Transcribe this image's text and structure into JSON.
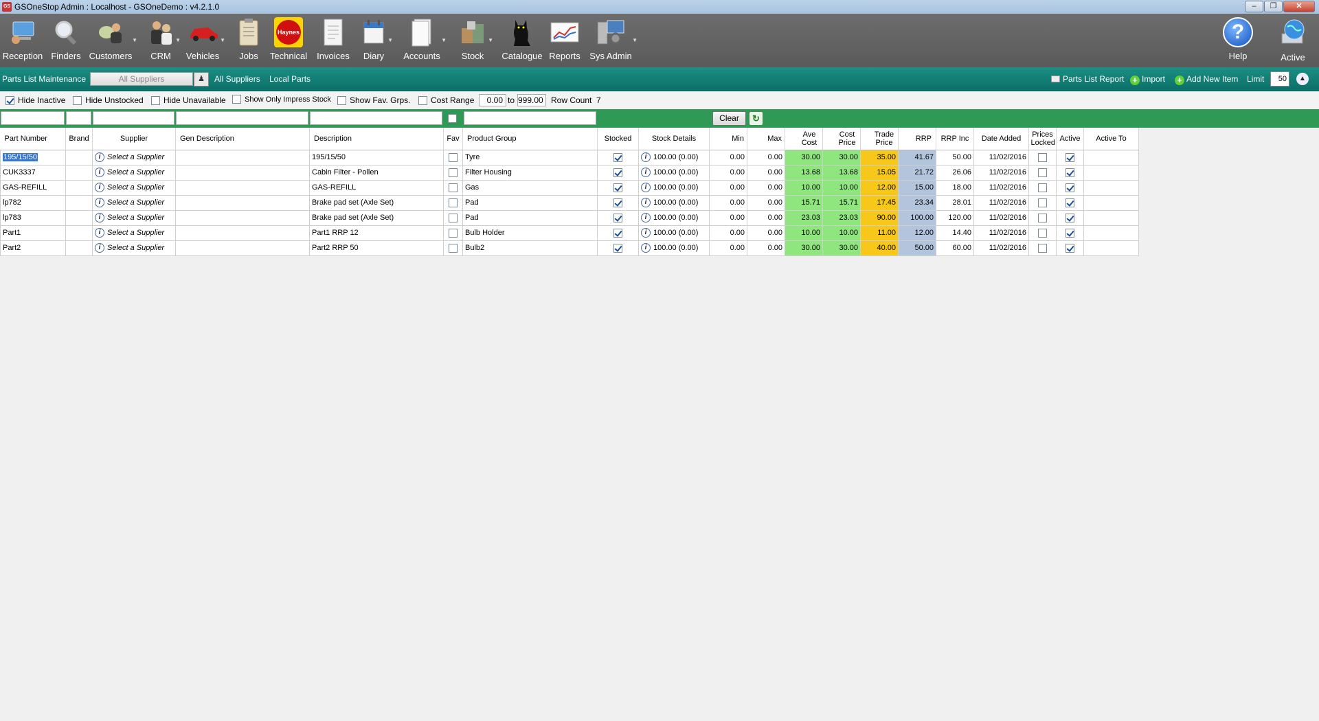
{
  "window": {
    "title": "GSOneStop Admin : Localhost - GSOneDemo : v4.2.1.0",
    "app_icon": "GS"
  },
  "toolbar": [
    {
      "label": "Reception",
      "icon": "reception-icon"
    },
    {
      "label": "Finders",
      "icon": "magnifier-icon"
    },
    {
      "label": "Customers",
      "icon": "customers-icon"
    },
    {
      "label": "CRM",
      "icon": "crm-icon"
    },
    {
      "label": "Vehicles",
      "icon": "car-icon"
    },
    {
      "label": "Jobs",
      "icon": "clipboard-icon"
    },
    {
      "label": "Technical",
      "icon": "haynes-icon",
      "badge": "Haynes"
    },
    {
      "label": "Invoices",
      "icon": "invoice-icon"
    },
    {
      "label": "Diary",
      "icon": "diary-icon"
    },
    {
      "label": "Accounts",
      "icon": "accounts-icon"
    },
    {
      "label": "Stock",
      "icon": "stock-icon"
    },
    {
      "label": "Catalogue",
      "icon": "cat-icon"
    },
    {
      "label": "Reports",
      "icon": "chart-icon"
    },
    {
      "label": "Sys Admin",
      "icon": "sysadmin-icon"
    },
    {
      "label": "Help",
      "icon": "help-icon"
    },
    {
      "label": "Active",
      "icon": "globe-icon"
    }
  ],
  "teal": {
    "title": "Parts List Maintenance",
    "supplier_select": "All Suppliers",
    "all_suppliers": "All Suppliers",
    "local_parts": "Local Parts",
    "report": "Parts List Report",
    "import": "Import",
    "add_new": "Add New Item",
    "limit_label": "Limit",
    "limit_value": "50"
  },
  "filters": {
    "hide_inactive": "Hide Inactive",
    "hide_unstocked": "Hide Unstocked",
    "hide_unavailable": "Hide Unavailable",
    "show_impress": "Show Only Impress Stock",
    "show_fav": "Show Fav. Grps.",
    "cost_range": "Cost Range",
    "range_from": "0.00",
    "range_to_label": "to",
    "range_to": "999.00",
    "row_count_label": "Row Count",
    "row_count": "7"
  },
  "clear_label": "Clear",
  "columns": [
    "Part Number",
    "Brand",
    "Supplier",
    "Gen Description",
    "Description",
    "Fav",
    "Product Group",
    "Stocked",
    "Stock Details",
    "Min",
    "Max",
    "Ave Cost",
    "Cost Price",
    "Trade Price",
    "RRP",
    "RRP Inc",
    "Date Added",
    "Prices Locked",
    "Active",
    "Active To"
  ],
  "rows": [
    {
      "part": "195/15/50",
      "brand": "",
      "supplier": "Select a Supplier",
      "gen": "",
      "desc": "195/15/50",
      "fav": false,
      "group": "Tyre",
      "stocked": true,
      "stock": "100.00 (0.00)",
      "min": "0.00",
      "max": "0.00",
      "ave": "30.00",
      "cost": "30.00",
      "trade": "35.00",
      "rrp": "41.67",
      "rrpinc": "50.00",
      "date": "11/02/2016",
      "locked": false,
      "active": true,
      "activeto": ""
    },
    {
      "part": "CUK3337",
      "brand": "",
      "supplier": "Select a Supplier",
      "gen": "",
      "desc": "Cabin Filter - Pollen",
      "fav": false,
      "group": "Filter Housing",
      "stocked": true,
      "stock": "100.00 (0.00)",
      "min": "0.00",
      "max": "0.00",
      "ave": "13.68",
      "cost": "13.68",
      "trade": "15.05",
      "rrp": "21.72",
      "rrpinc": "26.06",
      "date": "11/02/2016",
      "locked": false,
      "active": true,
      "activeto": ""
    },
    {
      "part": "GAS-REFILL",
      "brand": "",
      "supplier": "Select a Supplier",
      "gen": "",
      "desc": "GAS-REFILL",
      "fav": false,
      "group": "Gas",
      "stocked": true,
      "stock": "100.00 (0.00)",
      "min": "0.00",
      "max": "0.00",
      "ave": "10.00",
      "cost": "10.00",
      "trade": "12.00",
      "rrp": "15.00",
      "rrpinc": "18.00",
      "date": "11/02/2016",
      "locked": false,
      "active": true,
      "activeto": ""
    },
    {
      "part": "lp782",
      "brand": "",
      "supplier": "Select a Supplier",
      "gen": "",
      "desc": "Brake pad set (Axle Set)",
      "fav": false,
      "group": "Pad",
      "stocked": true,
      "stock": "100.00 (0.00)",
      "min": "0.00",
      "max": "0.00",
      "ave": "15.71",
      "cost": "15.71",
      "trade": "17.45",
      "rrp": "23.34",
      "rrpinc": "28.01",
      "date": "11/02/2016",
      "locked": false,
      "active": true,
      "activeto": ""
    },
    {
      "part": "lp783",
      "brand": "",
      "supplier": "Select a Supplier",
      "gen": "",
      "desc": "Brake pad set (Axle Set)",
      "fav": false,
      "group": "Pad",
      "stocked": true,
      "stock": "100.00 (0.00)",
      "min": "0.00",
      "max": "0.00",
      "ave": "23.03",
      "cost": "23.03",
      "trade": "90.00",
      "rrp": "100.00",
      "rrpinc": "120.00",
      "date": "11/02/2016",
      "locked": false,
      "active": true,
      "activeto": ""
    },
    {
      "part": "Part1",
      "brand": "",
      "supplier": "Select a Supplier",
      "gen": "",
      "desc": "Part1  RRP 12",
      "fav": false,
      "group": "Bulb Holder",
      "stocked": true,
      "stock": "100.00 (0.00)",
      "min": "0.00",
      "max": "0.00",
      "ave": "10.00",
      "cost": "10.00",
      "trade": "11.00",
      "rrp": "12.00",
      "rrpinc": "14.40",
      "date": "11/02/2016",
      "locked": false,
      "active": true,
      "activeto": ""
    },
    {
      "part": "Part2",
      "brand": "",
      "supplier": "Select a Supplier",
      "gen": "",
      "desc": "Part2  RRP 50",
      "fav": false,
      "group": "Bulb2",
      "stocked": true,
      "stock": "100.00 (0.00)",
      "min": "0.00",
      "max": "0.00",
      "ave": "30.00",
      "cost": "30.00",
      "trade": "40.00",
      "rrp": "50.00",
      "rrpinc": "60.00",
      "date": "11/02/2016",
      "locked": false,
      "active": true,
      "activeto": ""
    }
  ],
  "colors": {
    "teal": "#0f7a70",
    "green_bar": "#2f9a55",
    "ave_cost": "#8fe57e",
    "trade": "#f7c71a",
    "rrp": "#b3c5dd"
  }
}
